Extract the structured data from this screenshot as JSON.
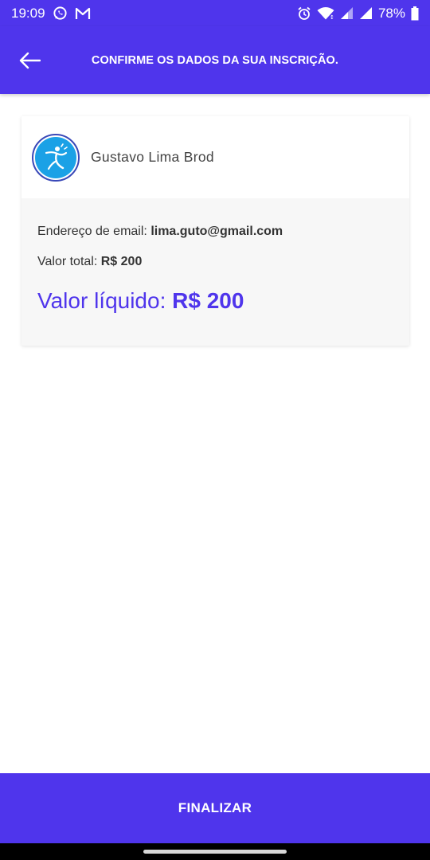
{
  "status_bar": {
    "time": "19:09",
    "battery": "78%",
    "icons_left": [
      "whatsapp-icon",
      "gmail-icon"
    ],
    "icons_right": [
      "alarm-icon",
      "wifi-icon",
      "signal-icon",
      "signal-icon",
      "battery-icon"
    ]
  },
  "header": {
    "title": "CONFIRME OS DADOS DA SUA INSCRIÇÃO.",
    "back_icon": "arrow-left-icon"
  },
  "card": {
    "user_name": "Gustavo Lima Brod",
    "email_label": "Endereço de email:",
    "email_value": "lima.guto@gmail.com",
    "total_label": "Valor total:",
    "total_value": "R$ 200",
    "net_label": "Valor líquido:",
    "net_value": "R$ 200"
  },
  "footer": {
    "finalize_label": "FINALIZAR"
  },
  "colors": {
    "primary": "#4f35ec",
    "avatar_bg": "#1ba1e6",
    "card_bg": "#f7f7f7"
  }
}
